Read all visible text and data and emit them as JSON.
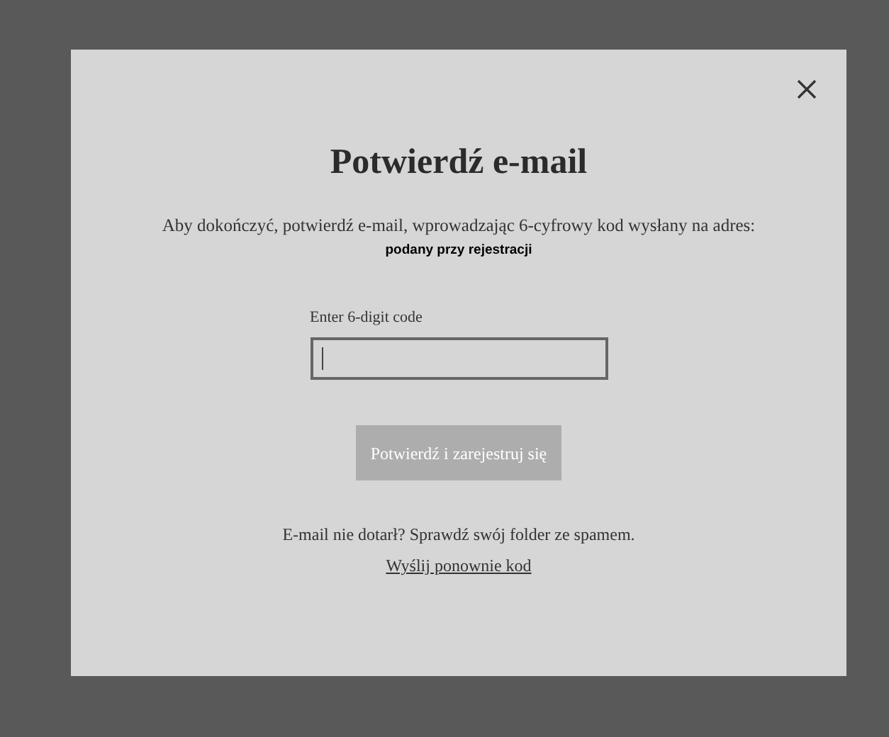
{
  "dialog": {
    "title": "Potwierdź e-mail",
    "message": "Aby dokończyć, potwierdź e-mail, wprowadzając 6-cyfrowy kod wysłany na adres:",
    "email": "podany przy rejestracji",
    "code_field": {
      "label": "Enter 6-digit code",
      "focused": true
    },
    "submit_button": {
      "label": "Potwierdź i zarejestruj się",
      "disabled": true
    },
    "hint": "E-mail nie dotarł? Sprawdź swój folder ze spamem.",
    "resend_link": "Wyślij ponownie kod"
  }
}
